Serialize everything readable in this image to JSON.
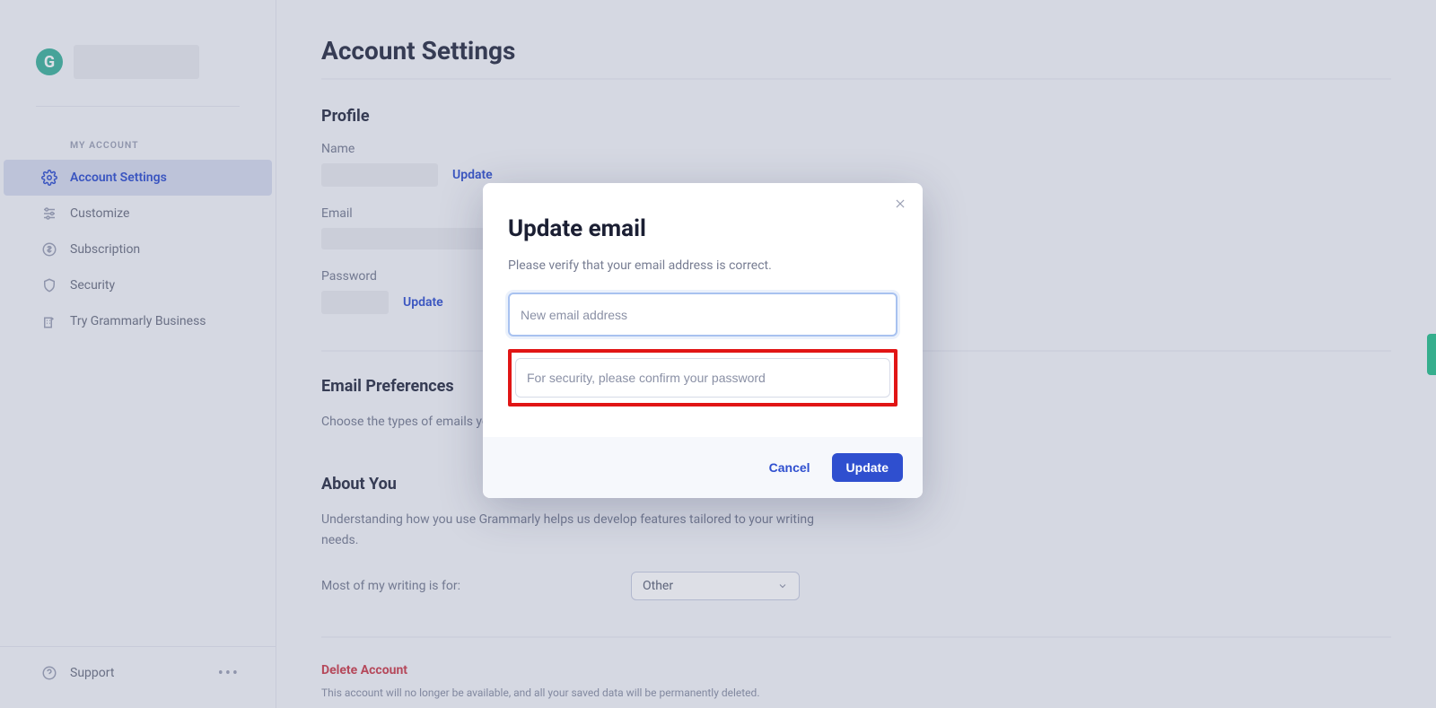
{
  "sidebar": {
    "logo_letter": "G",
    "section_label": "MY ACCOUNT",
    "items": [
      {
        "label": "Account Settings",
        "icon": "gear-icon",
        "active": true
      },
      {
        "label": "Customize",
        "icon": "sliders-icon",
        "active": false
      },
      {
        "label": "Subscription",
        "icon": "dollar-icon",
        "active": false
      },
      {
        "label": "Security",
        "icon": "shield-icon",
        "active": false
      },
      {
        "label": "Try Grammarly Business",
        "icon": "building-icon",
        "active": false
      }
    ],
    "support_label": "Support"
  },
  "page": {
    "title": "Account Settings",
    "profile": {
      "heading": "Profile",
      "name_label": "Name",
      "email_label": "Email",
      "password_label": "Password",
      "update_link": "Update"
    },
    "email_prefs": {
      "heading": "Email Preferences",
      "text_prefix": "Choose the types of emails you"
    },
    "about_you": {
      "heading": "About You",
      "text": "Understanding how you use Grammarly helps us develop features tailored to your writing needs.",
      "writing_label": "Most of my writing is for:",
      "select_value": "Other"
    },
    "delete": {
      "heading": "Delete Account",
      "text": "This account will no longer be available, and all your saved data will be permanently deleted."
    }
  },
  "modal": {
    "title": "Update email",
    "subtitle": "Please verify that your email address is correct.",
    "email_placeholder": "New email address",
    "password_placeholder": "For security, please confirm your password",
    "cancel_label": "Cancel",
    "update_label": "Update"
  }
}
